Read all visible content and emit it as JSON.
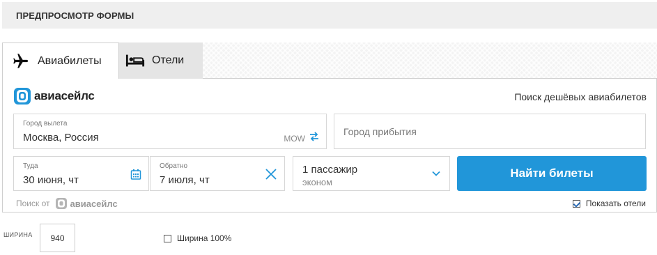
{
  "header": {
    "title": "ПРЕДПРОСМОТР ФОРМЫ"
  },
  "tabs": [
    {
      "label": "Авиабилеты",
      "icon": "airplane-icon",
      "active": true
    },
    {
      "label": "Отели",
      "icon": "bed-icon",
      "active": false
    }
  ],
  "brand": {
    "name": "авиасейлс",
    "tagline": "Поиск дешёвых авиабилетов",
    "color": "#2196d9"
  },
  "origin": {
    "label": "Город вылета",
    "value": "Москва, Россия",
    "iata": "MOW"
  },
  "destination": {
    "placeholder": "Город прибытия"
  },
  "depart": {
    "label": "Туда",
    "value": "30 июня, чт"
  },
  "return": {
    "label": "Обратно",
    "value": "7 июля, чт"
  },
  "passengers": {
    "count": "1 пассажир",
    "class": "эконом"
  },
  "search_button": {
    "label": "Найти билеты",
    "color": "#2196d9"
  },
  "powered": {
    "prefix": "Поиск от",
    "brand": "авиасейлс"
  },
  "show_hotels": {
    "label": "Показать отели",
    "checked": true
  },
  "settings": {
    "width_label": "ШИРИНА",
    "width_value": "940",
    "full_width_label": "Ширина 100%",
    "full_width_checked": false
  }
}
